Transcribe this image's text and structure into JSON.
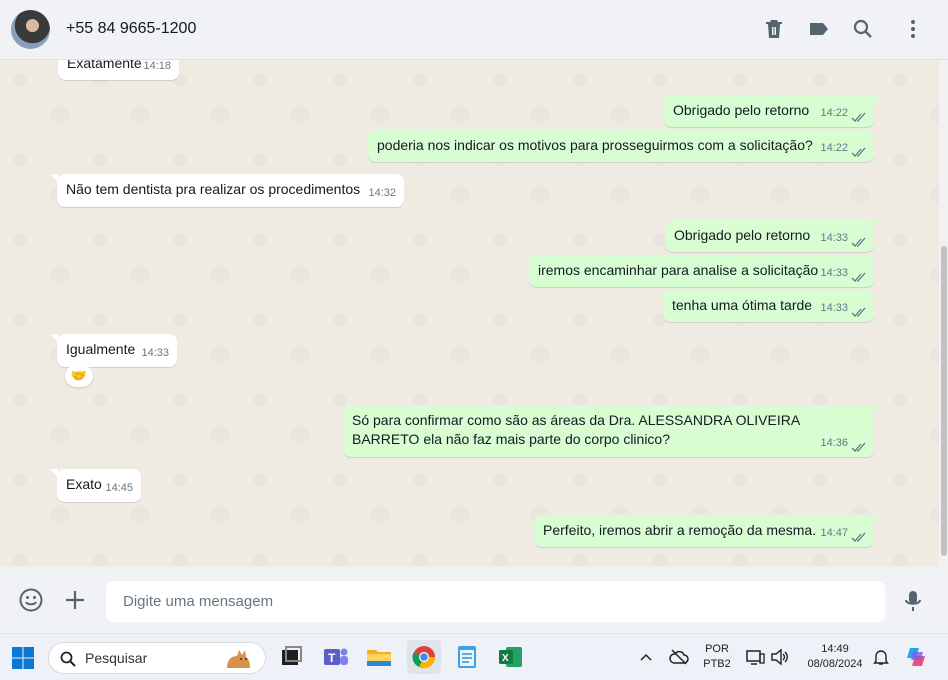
{
  "header": {
    "contact": "+55 84 9665-1200"
  },
  "messages": [
    {
      "dir": "in",
      "text": "Exatamente",
      "time": "14:18"
    },
    {
      "dir": "out",
      "text": "Obrigado pelo retorno",
      "time": "14:22"
    },
    {
      "dir": "out",
      "text": "poderia nos indicar os motivos para prosseguirmos com a solicitação?",
      "time": "14:22"
    },
    {
      "dir": "in",
      "text": "Não tem dentista pra realizar os procedimentos",
      "time": "14:32"
    },
    {
      "dir": "out",
      "text": "Obrigado pelo retorno",
      "time": "14:33"
    },
    {
      "dir": "out",
      "text": "iremos encaminhar para analise a solicitação",
      "time": "14:33"
    },
    {
      "dir": "out",
      "text": "tenha uma ótima tarde",
      "time": "14:33"
    },
    {
      "dir": "in",
      "text": "Igualmente",
      "time": "14:33",
      "reaction": "🤝"
    },
    {
      "dir": "out",
      "text": "Só para confirmar como são as áreas da Dra. ALESSANDRA OLIVEIRA BARRETO ela não faz mais parte do corpo clinico?",
      "time": "14:36"
    },
    {
      "dir": "in",
      "text": "Exato",
      "time": "14:45"
    },
    {
      "dir": "out",
      "text": "Perfeito, iremos abrir a remoção da mesma.",
      "time": "14:47"
    }
  ],
  "composer": {
    "placeholder": "Digite uma mensagem"
  },
  "taskbar": {
    "search_label": "Pesquisar",
    "lang_top": "POR",
    "lang_bottom": "PTB2",
    "clock_time": "14:49",
    "clock_date": "08/08/2024"
  },
  "colors": {
    "outgoing": "#d9fdd3",
    "incoming": "#ffffff",
    "tick": "#667781"
  }
}
